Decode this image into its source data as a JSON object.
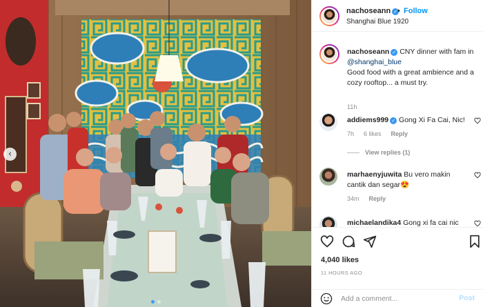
{
  "post": {
    "username": "nachoseann",
    "follow_label": "Follow",
    "bullet": "•",
    "location": "Shanghai Blue 1920",
    "more_icon": "more-horizontal-icon"
  },
  "caption": {
    "username": "nachoseann",
    "text_lines": [
      "CNY dinner with fam in",
      "@shanghai_blue",
      "Good food with a great ambience and a",
      "cozy rooftop... a must try."
    ],
    "time": "11h"
  },
  "comments": [
    {
      "username": "addiems999",
      "verified": true,
      "text": "Gong Xi Fa Cai, Nic!",
      "time": "7h",
      "likes": "6 likes",
      "reply": "Reply",
      "view_replies": "View replies (1)"
    },
    {
      "username": "marhaenyjuwita",
      "verified": false,
      "text": "Bu vero makin",
      "text2": "cantik dan segar",
      "emoji": "😍",
      "time": "34m",
      "reply": "Reply"
    },
    {
      "username": "michaelandika4",
      "verified": false,
      "text": "Gong xi fa cai nic"
    }
  ],
  "actions": {
    "likes": "4,040 likes",
    "timestamp": "11 HOURS AGO",
    "icons": [
      "heart-icon",
      "comment-icon",
      "share-icon",
      "bookmark-icon"
    ]
  },
  "add_comment": {
    "placeholder": "Add a comment...",
    "post_label": "Post"
  },
  "photo": {
    "slides": 2,
    "active_slide": 1,
    "prev_icon": "‹"
  },
  "colors": {
    "follow": "#0095f6",
    "verified": "#3897f0",
    "mural_blue": "#2e7fb8",
    "mural_yellow": "#e2c042",
    "wall_red": "#c22c2c"
  }
}
